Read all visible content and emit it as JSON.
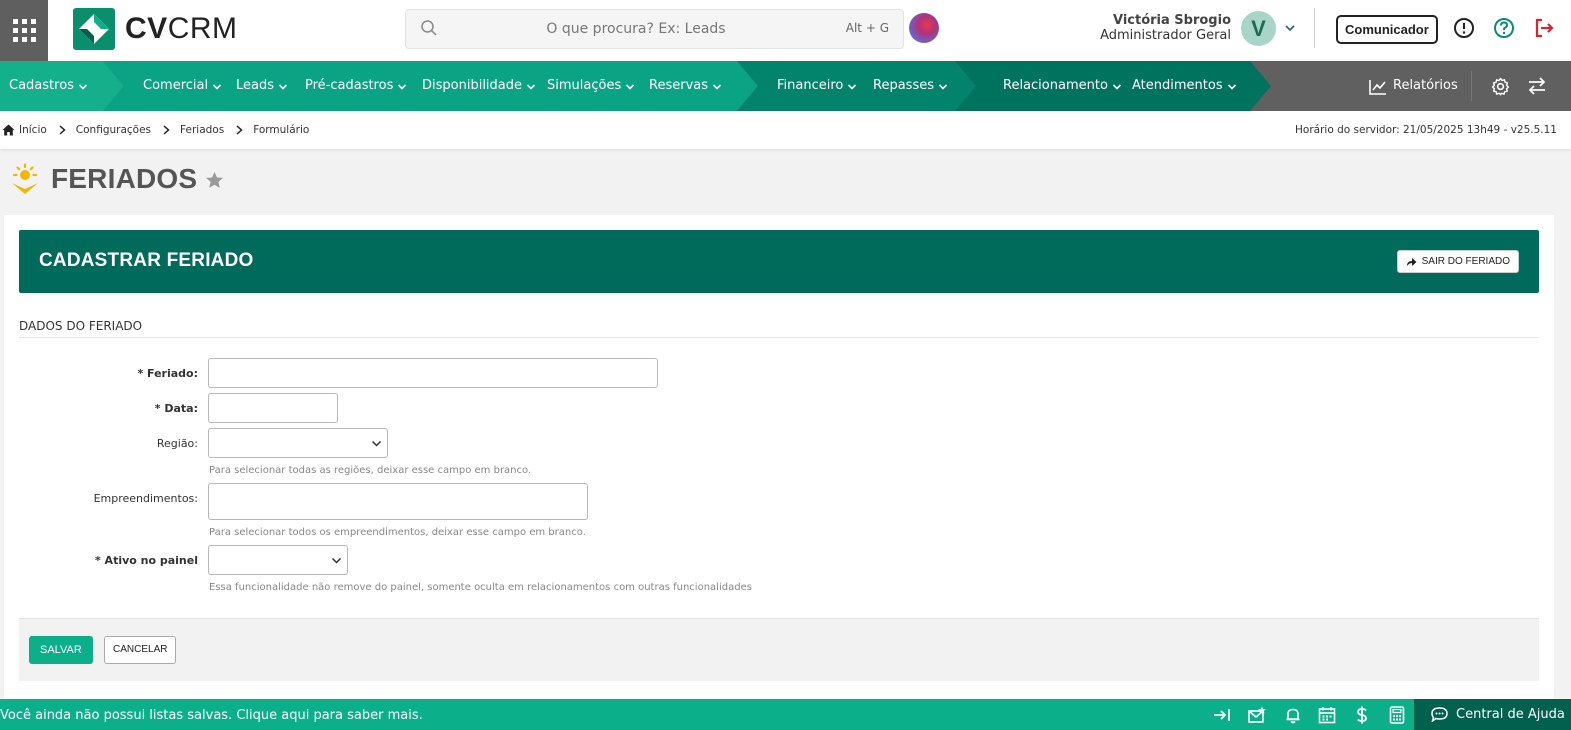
{
  "header": {
    "logo_bold": "CV",
    "logo_light": "CRM",
    "search_placeholder": "O que procura? Ex: Leads",
    "search_shortcut": "Alt + G",
    "user_name": "Victória Sbrogio",
    "user_role": "Administrador Geral",
    "avatar_initial": "V",
    "comunicador_label": "Comunicador"
  },
  "nav": {
    "items": [
      {
        "label": "Cadastros"
      },
      {
        "label": "Comercial"
      },
      {
        "label": "Leads"
      },
      {
        "label": "Pré-cadastros"
      },
      {
        "label": "Disponibilidade"
      },
      {
        "label": "Simulações"
      },
      {
        "label": "Reservas"
      },
      {
        "label": "Financeiro"
      },
      {
        "label": "Repasses"
      },
      {
        "label": "Relacionamento"
      },
      {
        "label": "Atendimentos"
      }
    ],
    "reports_label": "Relatórios",
    "colors": {
      "light_green": "#14b08b",
      "mid_green": "#0a9c7c",
      "dark_green": "#00735f",
      "gray": "#606060"
    }
  },
  "breadcrumb": {
    "items": [
      "Início",
      "Configurações",
      "Feriados",
      "Formulário"
    ],
    "server_time": "Horário do servidor: 21/05/2025 13h49 - v25.5.11"
  },
  "page": {
    "title": "FERIADOS"
  },
  "form": {
    "header_title": "CADASTRAR FERIADO",
    "exit_label": "SAIR DO FERIADO",
    "section_title": "DADOS DO FERIADO",
    "fields": {
      "feriado": {
        "label": "* Feriado:",
        "value": ""
      },
      "data": {
        "label": "* Data:",
        "value": ""
      },
      "regiao": {
        "label": "Região:",
        "value": "",
        "hint": "Para selecionar todas as regiões, deixar esse campo em branco."
      },
      "empreendimentos": {
        "label": "Empreendimentos:",
        "value": "",
        "hint": "Para selecionar todos os empreendimentos, deixar esse campo em branco."
      },
      "ativo": {
        "label": "* Ativo no painel",
        "value": "",
        "hint": "Essa funcionalidade não remove do painel, somente oculta em relacionamentos com outras funcionalidades"
      }
    },
    "save_label": "SALVAR",
    "cancel_label": "CANCELAR"
  },
  "bottombar": {
    "message": "Você ainda não possui listas salvas. Clique aqui para saber mais.",
    "help_label": "Central de Ajuda"
  }
}
